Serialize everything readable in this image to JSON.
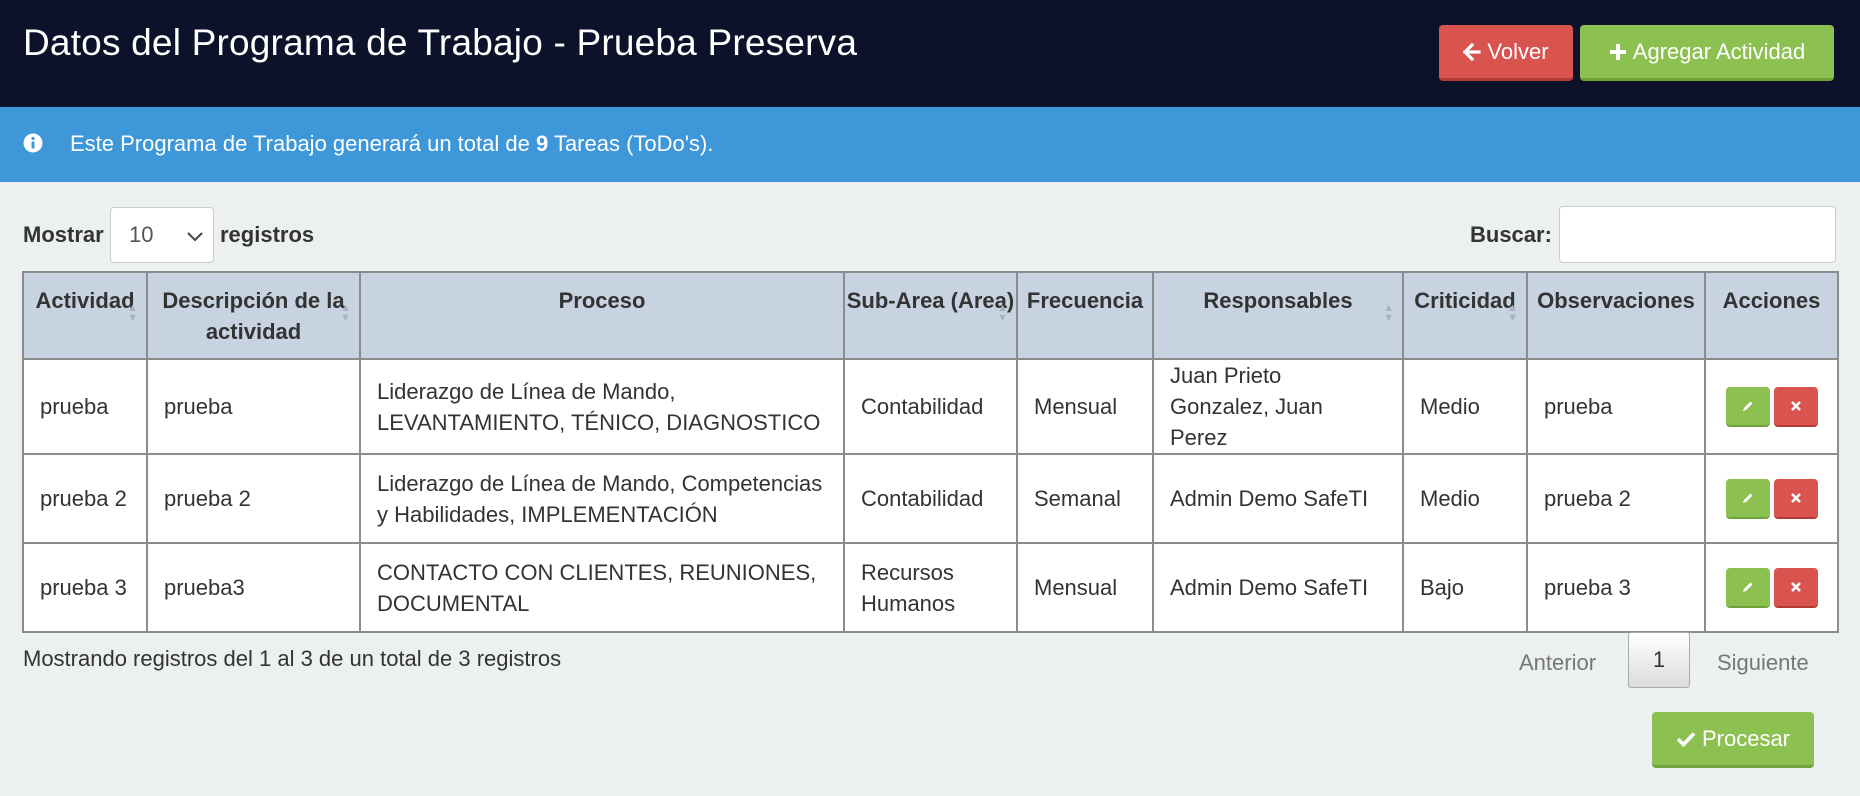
{
  "header": {
    "title": "Datos del Programa de Trabajo - Prueba Preserva",
    "back_label": "Volver",
    "add_label": "Agregar Actividad"
  },
  "info": {
    "prefix": "Este Programa de Trabajo generará un total de",
    "count": "9",
    "suffix": "Tareas (ToDo's)."
  },
  "table_controls": {
    "show_label": "Mostrar",
    "page_size": "10",
    "records_label": "registros",
    "search_label": "Buscar:",
    "search_value": ""
  },
  "table": {
    "columns": [
      "Actividad",
      "Descripción de la actividad",
      "Proceso",
      "Sub-Area (Area)",
      "Frecuencia",
      "Responsables",
      "Criticidad",
      "Observaciones",
      "Acciones"
    ],
    "rows": [
      {
        "actividad": "prueba",
        "descripcion": "prueba",
        "proceso": "Liderazgo de Línea de Mando, LEVANTAMIENTO, TÉNICO, DIAGNOSTICO",
        "subarea": "Contabilidad",
        "frecuencia": "Mensual",
        "responsables": "Juan Prieto Gonzalez, Juan Perez",
        "criticidad": "Medio",
        "observaciones": "prueba"
      },
      {
        "actividad": "prueba 2",
        "descripcion": "prueba 2",
        "proceso": "Liderazgo de Línea de Mando, Competencias y Habilidades, IMPLEMENTACIÓN",
        "subarea": "Contabilidad",
        "frecuencia": "Semanal",
        "responsables": "Admin Demo SafeTI",
        "criticidad": "Medio",
        "observaciones": "prueba 2"
      },
      {
        "actividad": "prueba 3",
        "descripcion": "prueba3",
        "proceso": "CONTACTO CON CLIENTES, REUNIONES, DOCUMENTAL",
        "subarea": "Recursos Humanos",
        "frecuencia": "Mensual",
        "responsables": "Admin Demo SafeTI",
        "criticidad": "Bajo",
        "observaciones": "prueba 3"
      }
    ]
  },
  "footer": {
    "summary": "Mostrando registros del 1 al 3 de un total de 3 registros",
    "prev_label": "Anterior",
    "current_page": "1",
    "next_label": "Siguiente",
    "process_label": "Procesar"
  },
  "colors": {
    "header_bg": "#0b1229",
    "info_bg": "#3d97d8",
    "danger": "#d9534f",
    "success": "#8cc152",
    "table_header_bg": "#c8d3e1",
    "page_bg": "#ecf0f1"
  },
  "icons": {
    "back": "arrow-left-icon",
    "add": "plus-icon",
    "info": "info-circle-icon",
    "edit": "pencil-icon",
    "delete": "times-icon",
    "process": "check-icon",
    "select": "chevron-down-icon"
  }
}
